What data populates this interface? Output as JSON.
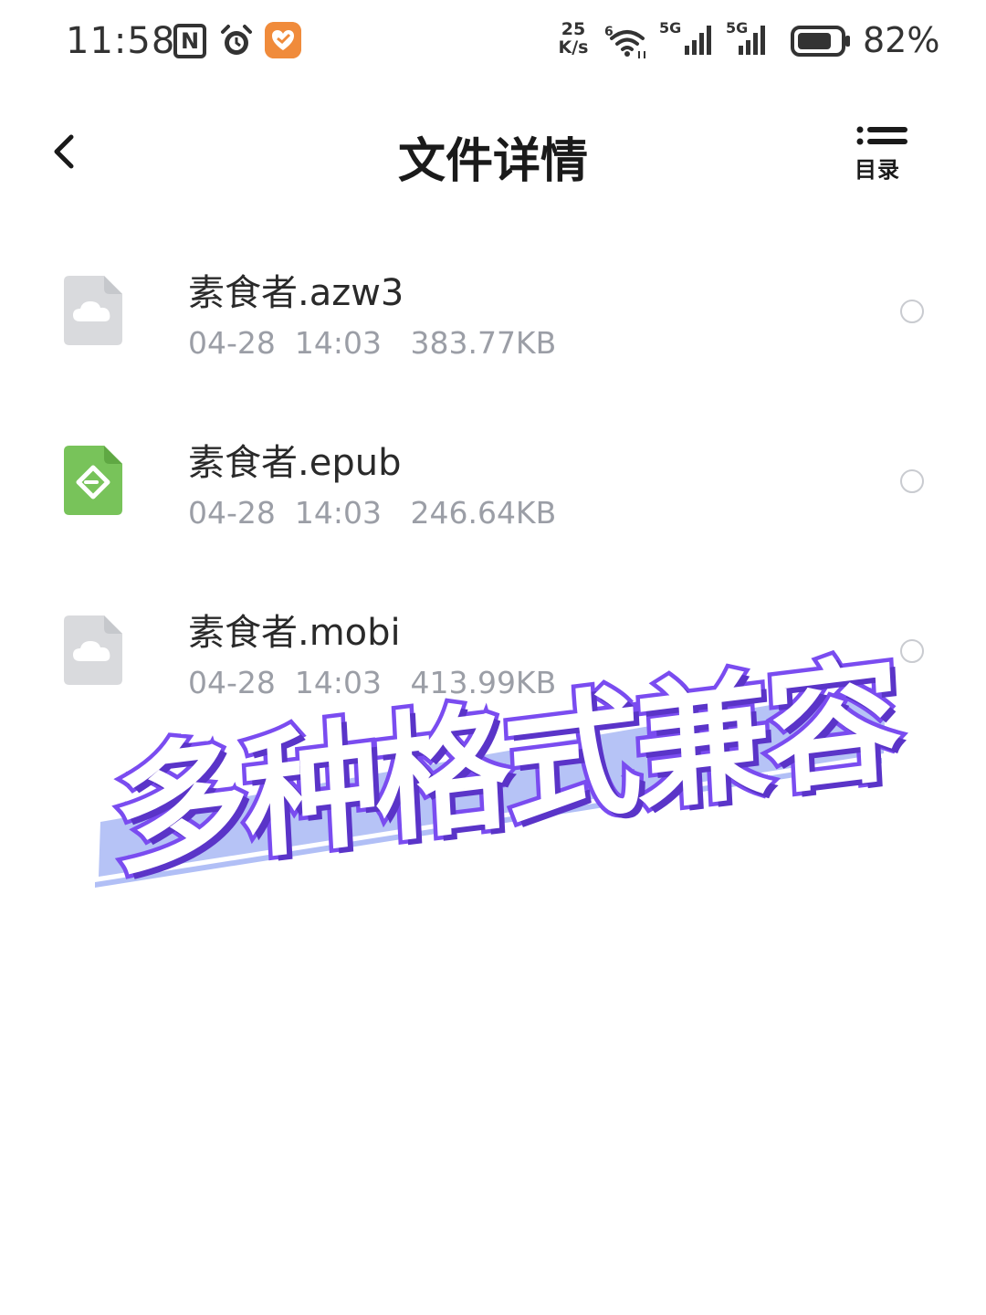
{
  "status_bar": {
    "time": "11:58",
    "nfc_label": "N",
    "net_speed_value": "25",
    "net_speed_unit": "K/s",
    "wifi_sup": "6",
    "signal1_label": "5G",
    "signal2_label": "5G",
    "battery_percent": "82%",
    "icons": [
      "nfc-icon",
      "alarm-icon",
      "app-badge-icon",
      "wifi-icon",
      "signal-icon",
      "signal-icon",
      "battery-icon"
    ],
    "battery_level": 0.82
  },
  "header": {
    "title": "文件详情",
    "back_icon": "chevron-left-icon",
    "toc_label": "目录",
    "toc_icon": "list-icon"
  },
  "files": [
    {
      "name": "素食者.azw3",
      "date": "04-28",
      "time": "14:03",
      "size": "383.77KB",
      "icon": "cloud-file-icon"
    },
    {
      "name": "素食者.epub",
      "date": "04-28",
      "time": "14:03",
      "size": "246.64KB",
      "icon": "epub-file-icon"
    },
    {
      "name": "素食者.mobi",
      "date": "04-28",
      "time": "14:03",
      "size": "413.99KB",
      "icon": "cloud-file-icon"
    }
  ],
  "banner": {
    "text": "多种格式兼容"
  },
  "colors": {
    "banner_stroke": "#7a4cf0",
    "banner_highlight": "#a9b8f5",
    "epub_green": "#78c35a",
    "cloud_file_gray": "#d9dadd",
    "meta_gray": "#9b9ea6",
    "app_badge_orange": "#f08b3b"
  }
}
